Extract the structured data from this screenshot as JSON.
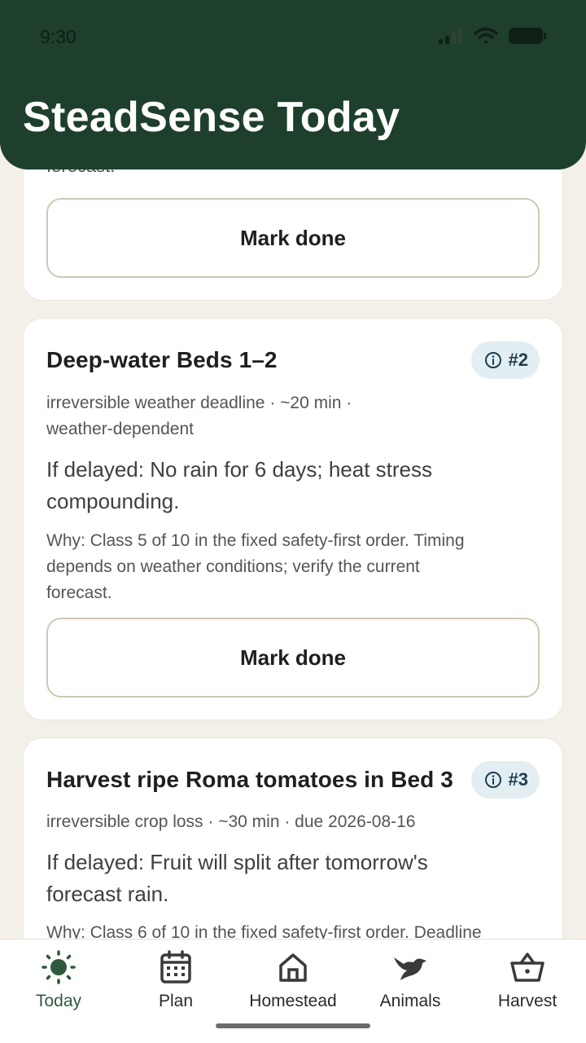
{
  "status_bar": {
    "time": "9:30"
  },
  "header": {
    "title": "SteadSense Today"
  },
  "cards": [
    {
      "partial_text": "forecast.",
      "button_label": "Mark done"
    },
    {
      "title": "Deep-water Beds 1–2",
      "rank": "#2",
      "meta_line1": "irreversible weather deadline · ~20 min ·",
      "meta_line2": "weather-dependent",
      "delay_line1": "If delayed: No rain for 6 days; heat stress",
      "delay_line2": "compounding.",
      "why_line1": "Why: Class 5 of 10 in the fixed safety-first order. Timing",
      "why_line2": "depends on weather conditions; verify the current",
      "why_line3": "forecast.",
      "button_label": "Mark done"
    },
    {
      "title": "Harvest ripe Roma tomatoes in Bed 3",
      "rank": "#3",
      "meta_line1": "irreversible crop loss · ~30 min · due 2026-08-16",
      "delay_line1": "If delayed: Fruit will split after tomorrow's",
      "delay_line2": "forecast rain.",
      "why_line1": "Why: Class 6 of 10 in the fixed safety-first order. Deadline"
    }
  ],
  "nav": [
    {
      "label": "Today",
      "icon": "sun-icon",
      "active": true
    },
    {
      "label": "Plan",
      "icon": "calendar-icon",
      "active": false
    },
    {
      "label": "Homestead",
      "icon": "house-icon",
      "active": false
    },
    {
      "label": "Animals",
      "icon": "bird-icon",
      "active": false
    },
    {
      "label": "Harvest",
      "icon": "basket-icon",
      "active": false
    }
  ],
  "colors": {
    "header_bg": "#1e3f2c",
    "page_bg": "#f3f0e9",
    "badge_bg": "#e3eef3",
    "active_nav": "#2e5a3b"
  }
}
